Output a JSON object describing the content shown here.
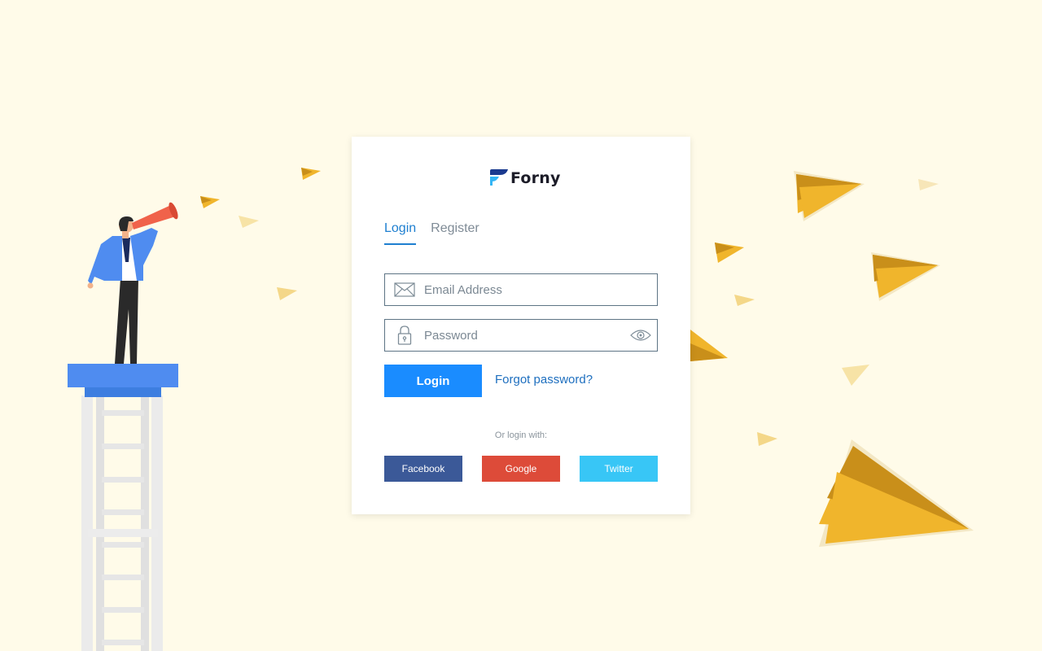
{
  "theme": {
    "background": "#fffbe9",
    "accent": "#1a8cff",
    "link": "#1e6fbf",
    "facebook": "#3b5998",
    "google": "#dd4b39",
    "twitter": "#38c6f6"
  },
  "brand": {
    "name": "Forny",
    "icon": "forny-logo-icon"
  },
  "tabs": [
    {
      "label": "Login",
      "active": true
    },
    {
      "label": "Register",
      "active": false
    }
  ],
  "form": {
    "email": {
      "placeholder": "Email Address",
      "value": "",
      "icon": "envelope-icon"
    },
    "password": {
      "placeholder": "Password",
      "value": "",
      "icon": "lock-icon",
      "toggle_icon": "eye-icon"
    },
    "login_label": "Login",
    "forgot_label": "Forgot password?"
  },
  "social": {
    "caption": "Or login with:",
    "buttons": [
      {
        "label": "Facebook"
      },
      {
        "label": "Google"
      },
      {
        "label": "Twitter"
      }
    ]
  }
}
